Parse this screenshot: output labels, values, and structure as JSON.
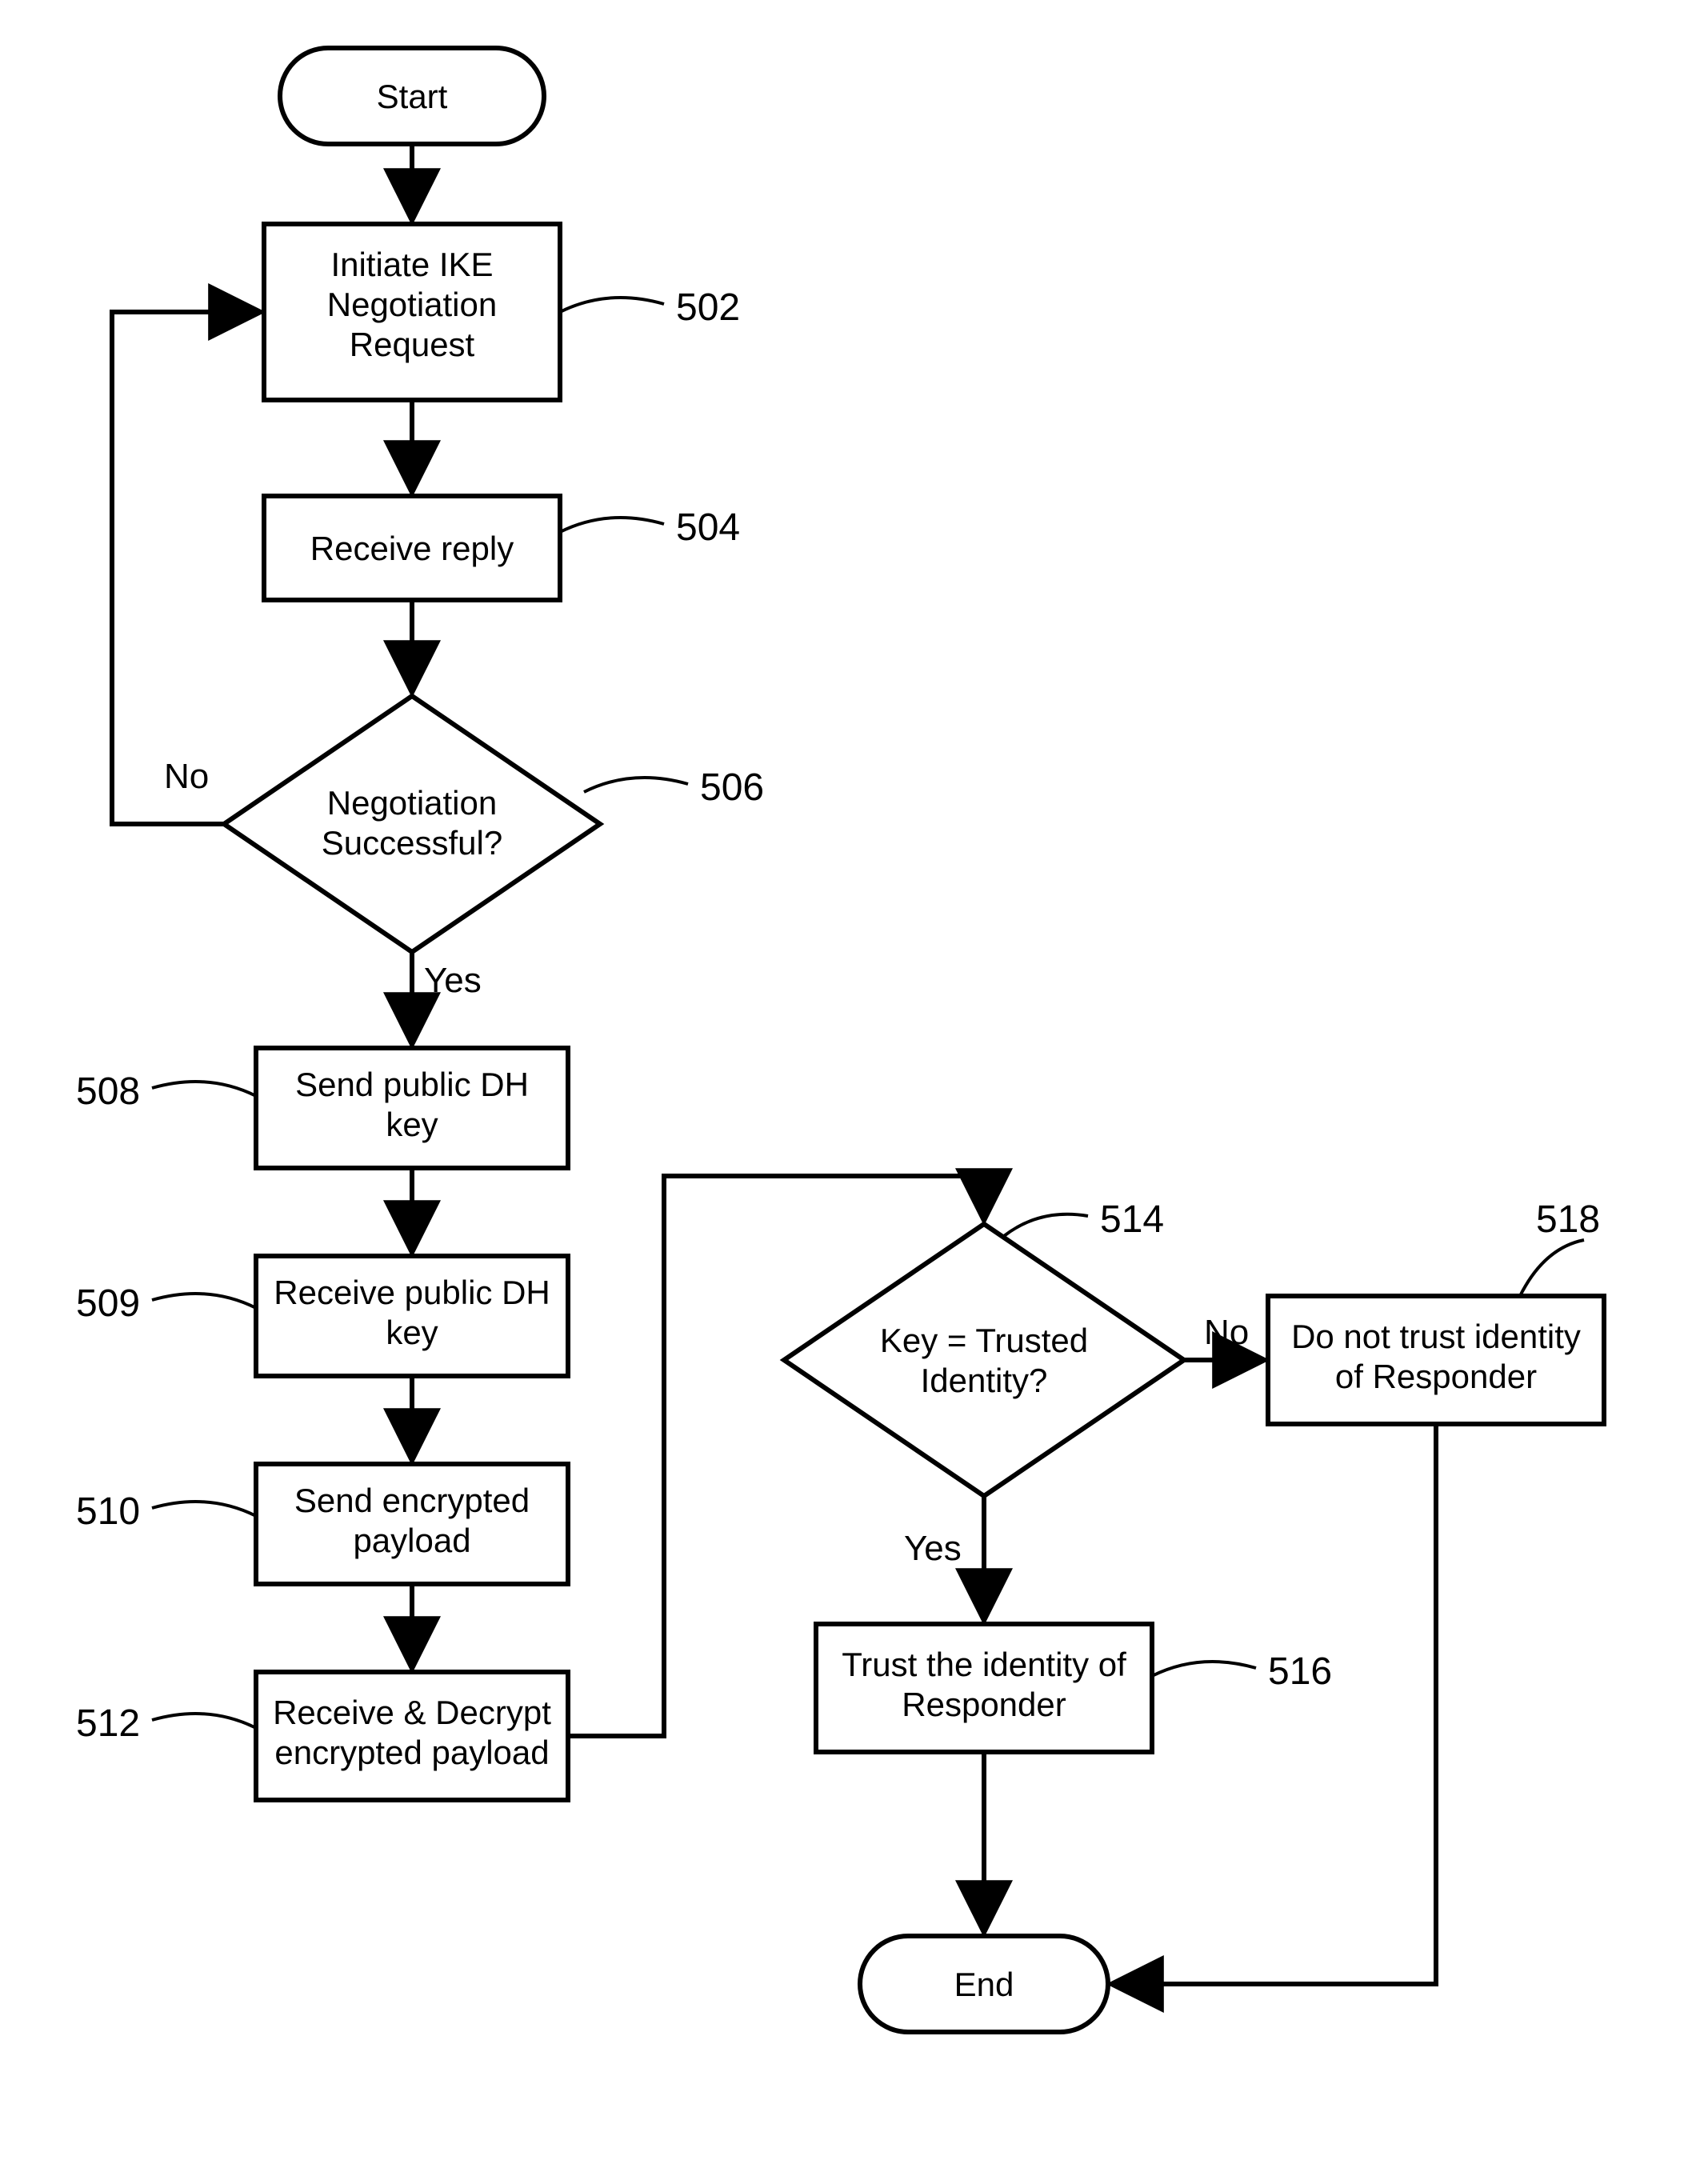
{
  "nodes": {
    "start": {
      "label": "Start"
    },
    "n502": {
      "label_line1": "Initiate IKE",
      "label_line2": "Negotiation",
      "label_line3": "Request",
      "ref": "502"
    },
    "n504": {
      "label": "Receive reply",
      "ref": "504"
    },
    "n506": {
      "label_line1": "Negotiation",
      "label_line2": "Successful?",
      "ref": "506"
    },
    "n508": {
      "label_line1": "Send public DH",
      "label_line2": "key",
      "ref": "508"
    },
    "n509": {
      "label_line1": "Receive public DH",
      "label_line2": "key",
      "ref": "509"
    },
    "n510": {
      "label_line1": "Send encrypted",
      "label_line2": "payload",
      "ref": "510"
    },
    "n512": {
      "label_line1": "Receive & Decrypt",
      "label_line2": "encrypted payload",
      "ref": "512"
    },
    "n514": {
      "label_line1": "Key = Trusted",
      "label_line2": "Identity?",
      "ref": "514"
    },
    "n516": {
      "label_line1": "Trust the identity of",
      "label_line2": "Responder",
      "ref": "516"
    },
    "n518": {
      "label_line1": "Do not trust identity",
      "label_line2": "of Responder",
      "ref": "518"
    },
    "end": {
      "label": "End"
    }
  },
  "edges": {
    "yes": "Yes",
    "no": "No"
  }
}
